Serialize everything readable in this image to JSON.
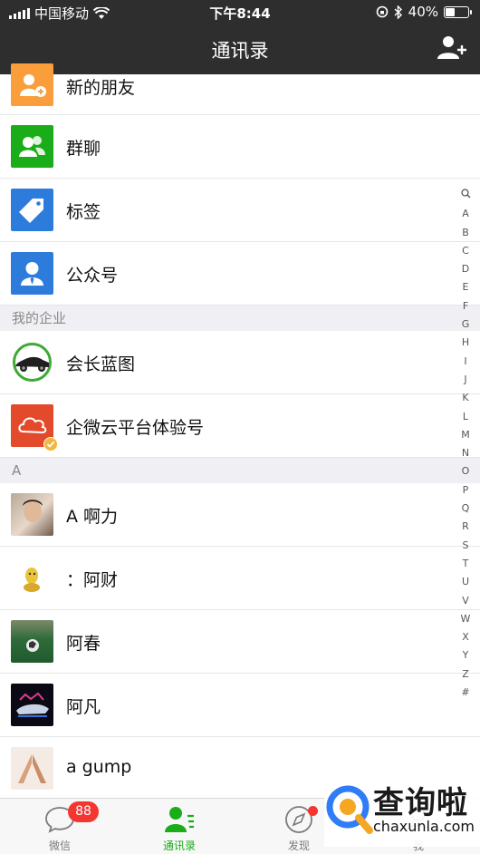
{
  "status": {
    "carrier": "中国移动",
    "time": "下午8:44",
    "battery_percent": "40%",
    "battery_level": 0.4
  },
  "nav": {
    "title": "通讯录",
    "add_icon": "add-contact-icon"
  },
  "contacts": [
    {
      "name": "新的朋友",
      "icon": "new-friend-icon",
      "color": "#fa9d3b"
    },
    {
      "name": "群聊",
      "icon": "group-chat-icon",
      "color": "#1aad19"
    },
    {
      "name": "标签",
      "icon": "tag-icon",
      "color": "#2d7cdb"
    },
    {
      "name": "公众号",
      "icon": "official-account-icon",
      "color": "#2d7cdb"
    }
  ],
  "sections": {
    "enterprise": {
      "title": "我的企业"
    },
    "a": {
      "title": "A"
    }
  },
  "enterprise_items": [
    {
      "name": "会长蓝图"
    },
    {
      "name": "企微云平台体验号"
    }
  ],
  "a_items": [
    {
      "name": "A 啊力"
    },
    {
      "name": "：阿财"
    },
    {
      "name": "阿春"
    },
    {
      "name": "阿凡"
    },
    {
      "name": "a gump"
    }
  ],
  "index_letters": [
    "A",
    "B",
    "C",
    "D",
    "E",
    "F",
    "G",
    "H",
    "I",
    "J",
    "K",
    "L",
    "M",
    "N",
    "O",
    "P",
    "Q",
    "R",
    "S",
    "T",
    "U",
    "V",
    "W",
    "X",
    "Y",
    "Z",
    "#"
  ],
  "tabs": [
    {
      "label": "微信",
      "icon": "chat-icon",
      "badge": "88"
    },
    {
      "label": "通讯录",
      "icon": "contacts-icon",
      "active": true
    },
    {
      "label": "发现",
      "icon": "compass-icon",
      "dot": true
    },
    {
      "label": "我",
      "icon": "me-icon"
    }
  ],
  "colors": {
    "accent": "#1aad19",
    "header": "#2e2e2e",
    "badge": "#f43530"
  },
  "watermark": {
    "brand": "查询啦",
    "url": "chaxunla.com"
  }
}
